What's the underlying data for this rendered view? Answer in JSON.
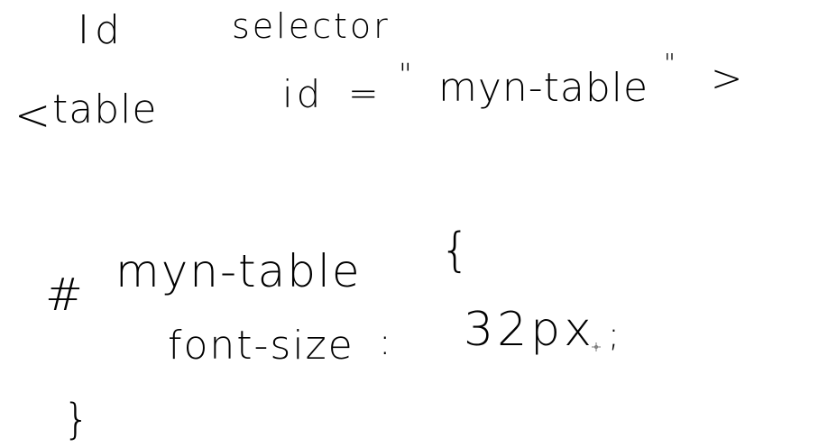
{
  "note": {
    "title_id": "Id",
    "title_selector": "selector",
    "html_line": {
      "open_bracket": "<",
      "tag": "table",
      "attr": "id",
      "equals": "=",
      "quote_open": "\"",
      "value": "myn-table",
      "quote_close": "\"",
      "close_bracket": ">"
    },
    "css_rule": {
      "hash": "#",
      "selector_name": "myn-table",
      "open_brace": "{",
      "property": "font-size",
      "colon": ":",
      "value": "32px",
      "semicolon": ";",
      "close_brace": "}"
    }
  },
  "colors": {
    "ink": "#000000",
    "background": "#ffffff"
  },
  "icons": {
    "pen_cursor": "crosshair-cursor-icon"
  }
}
